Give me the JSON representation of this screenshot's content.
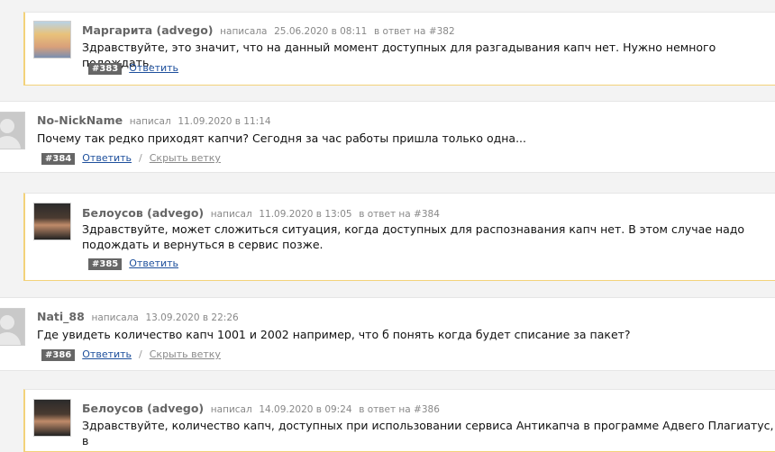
{
  "comments": [
    {
      "author": "Маргарита (advego)",
      "verb": "написала",
      "datetime": "25.06.2020 в 08:11",
      "reply_to": "в ответ на #382",
      "text": "Здравствуйте, это значит, что на данный момент доступных для разгадывания капч нет. Нужно немного подождать.",
      "num": "#383",
      "reply": "Ответить"
    },
    {
      "author": "No-NickName",
      "verb": "написал",
      "datetime": "11.09.2020 в 11:14",
      "text": "Почему так редко приходят капчи? Сегодня за час работы пришла только одна...",
      "num": "#384",
      "reply": "Ответить",
      "separator": "/",
      "hide": "Скрыть ветку"
    },
    {
      "author": "Белоусов (advego)",
      "verb": "написал",
      "datetime": "11.09.2020 в 13:05",
      "reply_to": "в ответ на #384",
      "text": "Здравствуйте, может сложиться ситуация, когда доступных для распознавания капч нет. В этом случае надо подождать и вернуться в сервис позже.",
      "num": "#385",
      "reply": "Ответить"
    },
    {
      "author": "Nati_88",
      "verb": "написала",
      "datetime": "13.09.2020 в 22:26",
      "text": "Где увидеть количество капч 1001 и 2002 например, что б понять когда будет списание за пакет?",
      "num": "#386",
      "reply": "Ответить",
      "separator": "/",
      "hide": "Скрыть ветку"
    },
    {
      "author": "Белоусов (advego)",
      "verb": "написал",
      "datetime": "14.09.2020 в 09:24",
      "reply_to": "в ответ на #386",
      "text": "Здравствуйте, количество капч, доступных при использовании сервиса Антикапча в программе Адвего Плагиатус, в"
    }
  ]
}
